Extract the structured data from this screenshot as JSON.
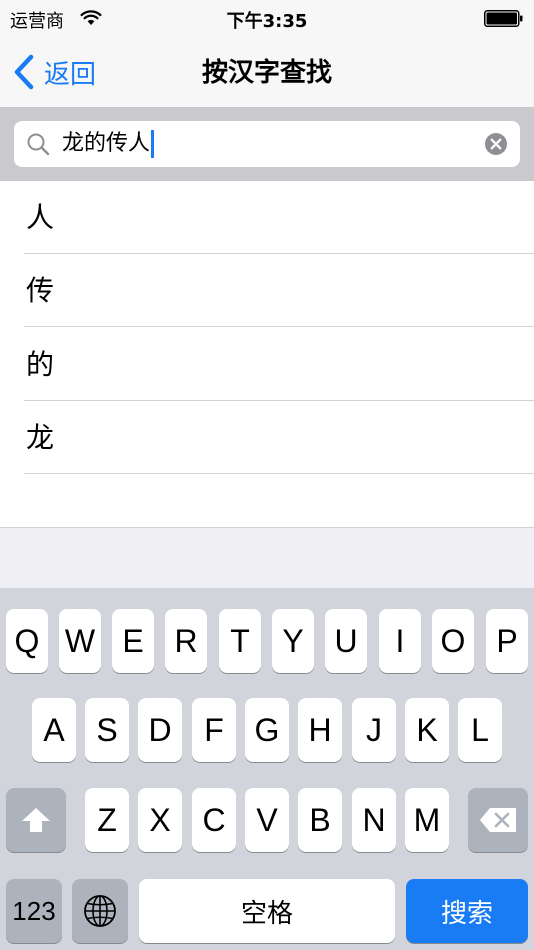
{
  "status_bar": {
    "carrier": "运营商",
    "time": "下午3:35"
  },
  "nav": {
    "back_label": "返回",
    "title": "按汉字查找"
  },
  "search": {
    "value": "龙的传人"
  },
  "results": [
    {
      "char": "人"
    },
    {
      "char": "传"
    },
    {
      "char": "的"
    },
    {
      "char": "龙"
    }
  ],
  "keyboard": {
    "row1": [
      "Q",
      "W",
      "E",
      "R",
      "T",
      "Y",
      "U",
      "I",
      "O",
      "P"
    ],
    "row2": [
      "A",
      "S",
      "D",
      "F",
      "G",
      "H",
      "J",
      "K",
      "L"
    ],
    "row3": [
      "Z",
      "X",
      "C",
      "V",
      "B",
      "N",
      "M"
    ],
    "numbers_label": "123",
    "space_label": "空格",
    "search_label": "搜索"
  },
  "colors": {
    "accent": "#1a7cf5",
    "keyboard_bg": "#d1d5db",
    "function_key": "#adb3bc",
    "search_bar_bg": "#c9c9ce"
  },
  "icons": [
    "wifi-icon",
    "battery-icon",
    "back-chevron-icon",
    "search-icon",
    "clear-icon",
    "shift-icon",
    "backspace-icon",
    "globe-icon"
  ]
}
